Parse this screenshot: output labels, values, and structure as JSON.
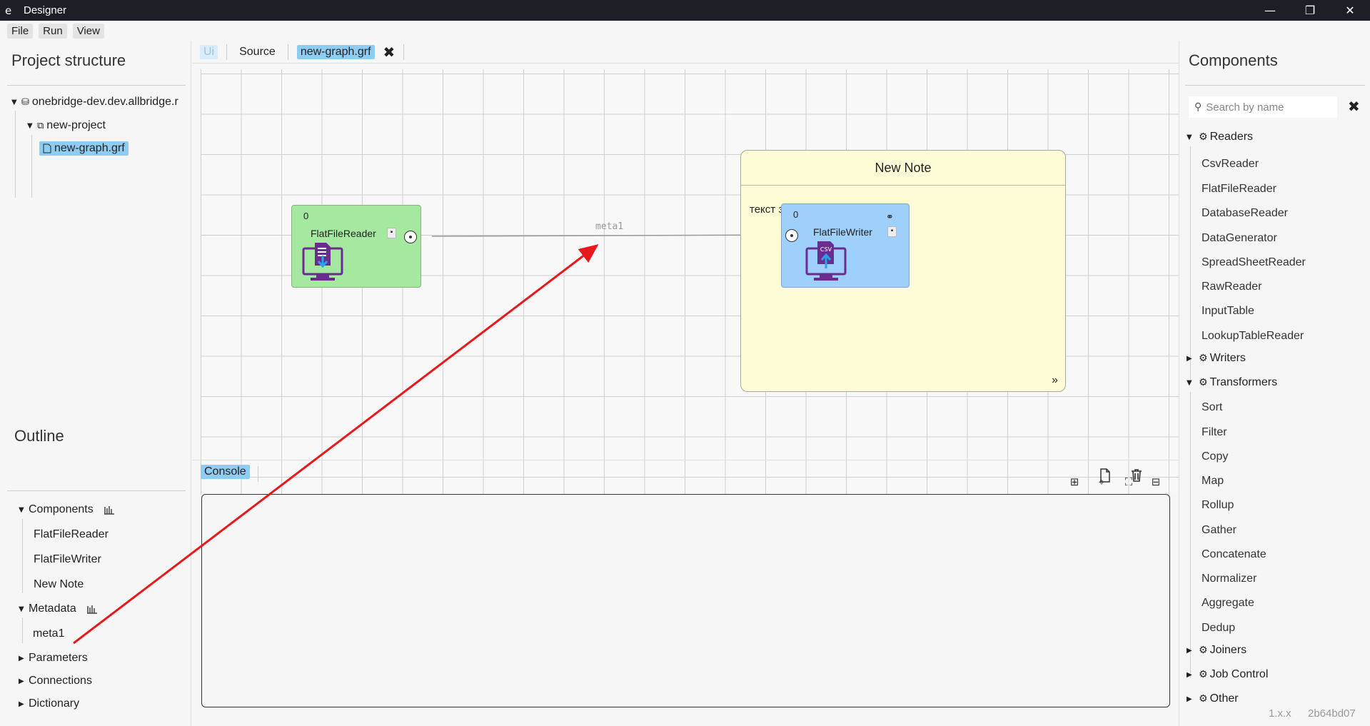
{
  "window": {
    "icon": "e",
    "title": "Designer",
    "controls": [
      "minimize-icon",
      "restore-icon",
      "close-icon"
    ]
  },
  "menu": [
    "File",
    "Run",
    "View"
  ],
  "project": {
    "title": "Project structure",
    "server": "onebridge-dev.dev.allbridge.r",
    "project_name": "new-project",
    "file": "new-graph.grf"
  },
  "outline": {
    "title": "Outline",
    "components_label": "Components",
    "components": [
      "FlatFileReader",
      "FlatFileWriter",
      "New Note"
    ],
    "metadata_label": "Metadata",
    "metadata": [
      "meta1"
    ],
    "parameters_label": "Parameters",
    "connections_label": "Connections",
    "dictionary_label": "Dictionary"
  },
  "tabs": {
    "ui": "Ui",
    "source": "Source",
    "file": "new-graph.grf"
  },
  "graph": {
    "reader": {
      "count": "0",
      "label": "FlatFileReader",
      "color": "#a5e8a0"
    },
    "writer": {
      "count": "0",
      "label": "FlatFileWriter",
      "badge": "CSV",
      "color": "#9fd0fb"
    },
    "edge_label": "meta1",
    "note": {
      "title": "New Note",
      "text": "текст заметки",
      "more": "»",
      "color": "#fdfcd7"
    }
  },
  "console": {
    "tab": "Console"
  },
  "components_panel": {
    "title": "Components",
    "search_placeholder": "Search by name",
    "readers_label": "Readers",
    "readers": [
      "CsvReader",
      "FlatFileReader",
      "DatabaseReader",
      "DataGenerator",
      "SpreadSheetReader",
      "RawReader",
      "InputTable",
      "LookupTableReader"
    ],
    "writers_label": "Writers",
    "transformers_label": "Transformers",
    "transformers": [
      "Sort",
      "Filter",
      "Copy",
      "Map",
      "Rollup",
      "Gather",
      "Concatenate",
      "Normalizer",
      "Aggregate",
      "Dedup"
    ],
    "joiners_label": "Joiners",
    "jobcontrol_label": "Job Control",
    "other_label": "Other"
  },
  "version": {
    "number": "1.x.x",
    "hash": "2b64bd07"
  },
  "colors": {
    "accent": "#8ecdf3",
    "annotation_arrow": "#e8181b",
    "titlebar": "#1c1f26"
  }
}
